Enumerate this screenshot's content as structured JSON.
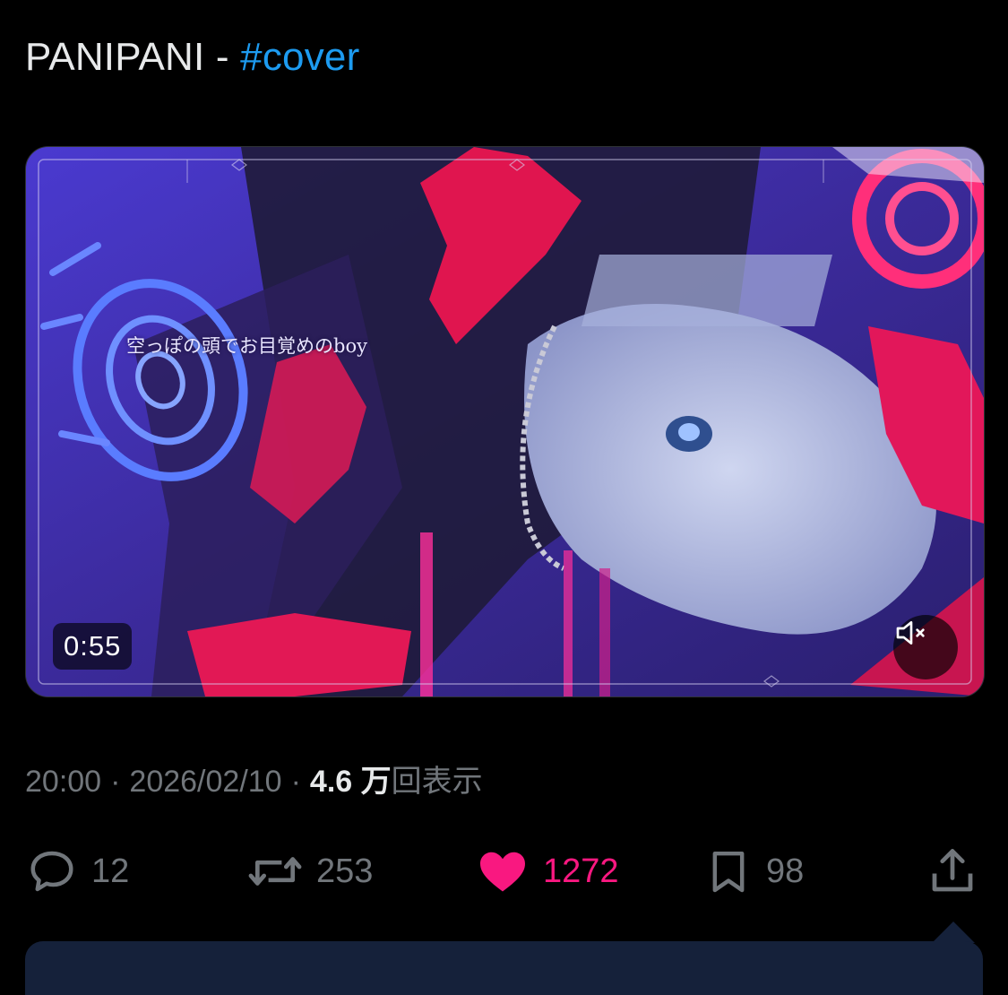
{
  "tweet": {
    "text_prefix": "PANIPANI - ",
    "hashtag": "#cover"
  },
  "video": {
    "lyric_overlay": "空っぽの頭でお目覚めのboy",
    "duration": "0:55",
    "mute_icon": "speaker-muted-icon"
  },
  "meta": {
    "time": "20:00",
    "separator": "·",
    "date": "2026/02/10",
    "views_count": "4.6 万",
    "views_label": "回表示"
  },
  "actions": {
    "reply_count": "12",
    "repost_count": "253",
    "like_count": "1272",
    "bookmark_count": "98"
  },
  "colors": {
    "background": "#000000",
    "text": "#e7e9ea",
    "muted": "#71767b",
    "hashtag": "#1d9bf0",
    "like": "#f91880"
  }
}
